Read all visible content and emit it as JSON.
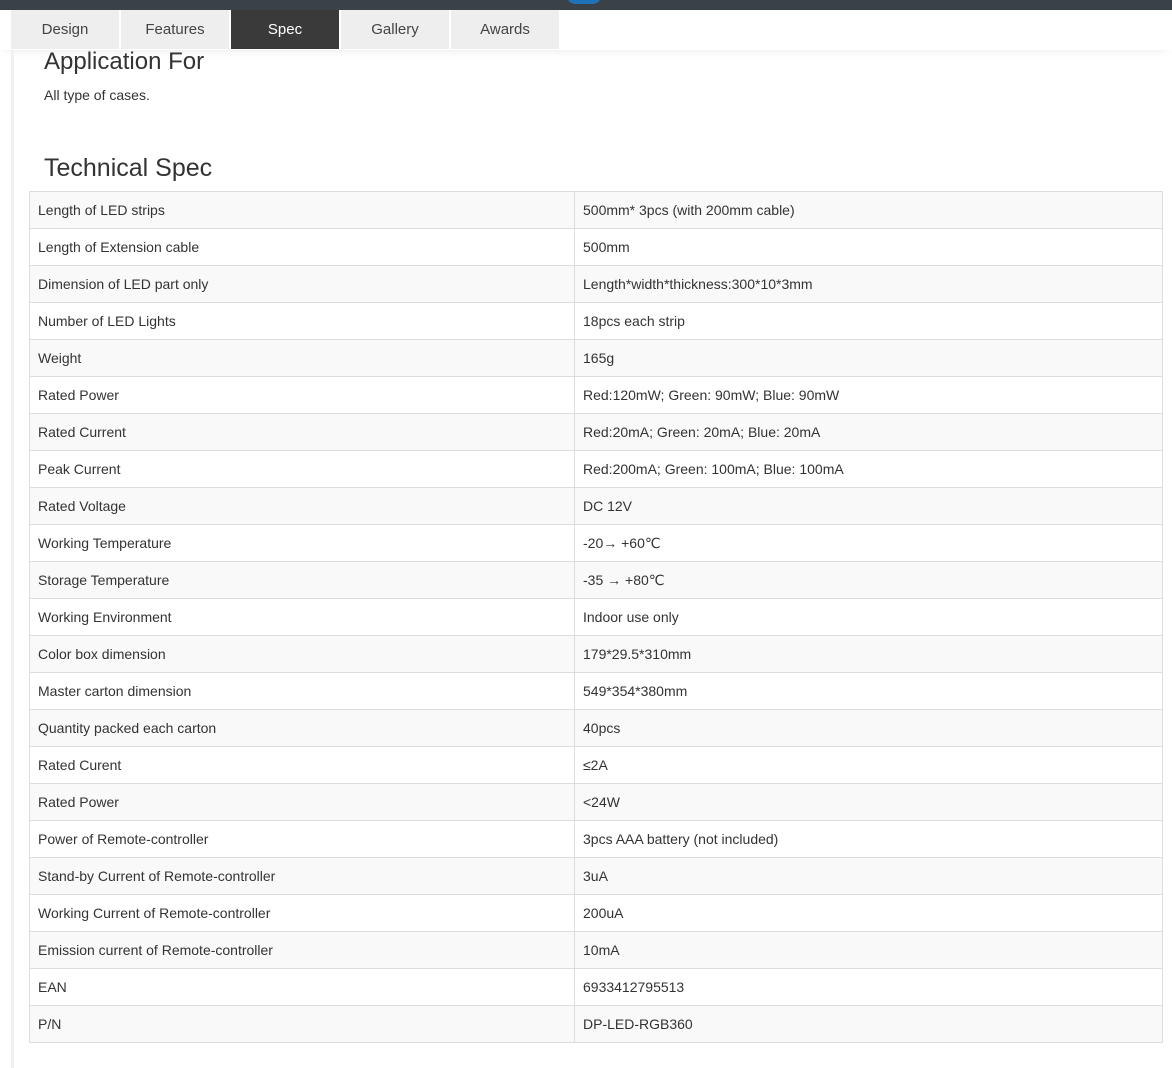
{
  "tabs": [
    {
      "label": "Design",
      "active": false
    },
    {
      "label": "Features",
      "active": false
    },
    {
      "label": "Spec",
      "active": true
    },
    {
      "label": "Gallery",
      "active": false
    },
    {
      "label": "Awards",
      "active": false
    }
  ],
  "application": {
    "title": "Application For",
    "text": "All type of cases."
  },
  "technical_spec": {
    "title": "Technical Spec",
    "rows": [
      {
        "key": "Length of LED strips",
        "value": "500mm* 3pcs (with 200mm cable)"
      },
      {
        "key": "Length of Extension cable",
        "value": "500mm"
      },
      {
        "key": "Dimension of LED part only",
        "value": "Length*width*thickness:300*10*3mm"
      },
      {
        "key": "Number of LED Lights",
        "value": "18pcs each strip"
      },
      {
        "key": "Weight",
        "value": "165g"
      },
      {
        "key": "Rated Power",
        "value": "Red:120mW; Green: 90mW; Blue: 90mW"
      },
      {
        "key": "Rated Current",
        "value": "Red:20mA; Green: 20mA; Blue: 20mA"
      },
      {
        "key": "Peak Current",
        "value": "Red:200mA; Green: 100mA; Blue: 100mA"
      },
      {
        "key": "Rated Voltage",
        "value": "DC 12V"
      },
      {
        "key": "Working Temperature",
        "value": "-20→ +60℃"
      },
      {
        "key": "Storage Temperature",
        "value": "-35 → +80℃"
      },
      {
        "key": "Working Environment",
        "value": "Indoor use only"
      },
      {
        "key": "Color box dimension",
        "value": "179*29.5*310mm"
      },
      {
        "key": "Master carton dimension",
        "value": "549*354*380mm"
      },
      {
        "key": "Quantity packed each carton",
        "value": "40pcs"
      },
      {
        "key": "Rated Curent",
        "value": "≤2A"
      },
      {
        "key": "Rated Power",
        "value": "<24W"
      },
      {
        "key": "Power of Remote-controller",
        "value": "3pcs AAA battery (not included)"
      },
      {
        "key": "Stand-by Current of Remote-controller",
        "value": "3uA"
      },
      {
        "key": "Working Current of Remote-controller",
        "value": "200uA"
      },
      {
        "key": "Emission current of Remote-controller",
        "value": "10mA"
      },
      {
        "key": "EAN",
        "value": "6933412795513"
      },
      {
        "key": "P/N",
        "value": "DP-LED-RGB360"
      }
    ]
  }
}
